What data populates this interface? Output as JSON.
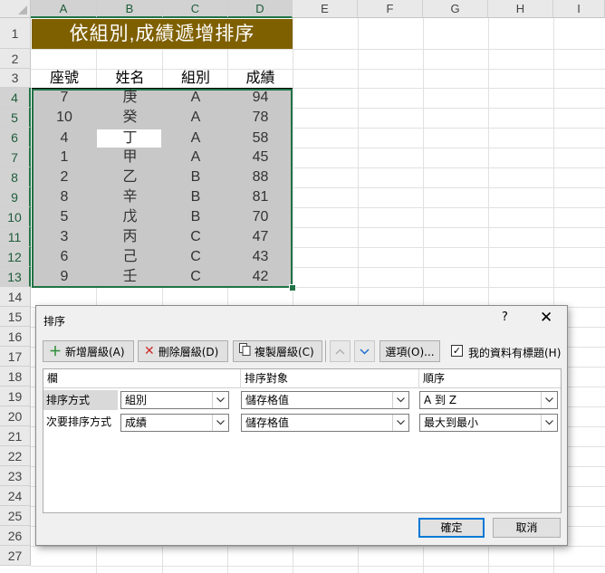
{
  "sheet": {
    "columns": [
      "A",
      "B",
      "C",
      "D",
      "E",
      "F",
      "G",
      "H",
      "I"
    ],
    "rows": [
      "1",
      "2",
      "3",
      "4",
      "5",
      "6",
      "7",
      "8",
      "9",
      "10",
      "11",
      "12",
      "13",
      "14",
      "15",
      "16",
      "17",
      "18",
      "19",
      "20",
      "21",
      "22",
      "23",
      "24",
      "25",
      "26",
      "27"
    ],
    "title": "依組別,成績遞增排序",
    "headers": {
      "seat": "座號",
      "name": "姓名",
      "group": "組別",
      "score": "成績"
    },
    "data": [
      {
        "seat": "7",
        "name": "庚",
        "group": "A",
        "score": "94"
      },
      {
        "seat": "10",
        "name": "癸",
        "group": "A",
        "score": "78"
      },
      {
        "seat": "4",
        "name": "丁",
        "group": "A",
        "score": "58"
      },
      {
        "seat": "1",
        "name": "甲",
        "group": "A",
        "score": "45"
      },
      {
        "seat": "2",
        "name": "乙",
        "group": "B",
        "score": "88"
      },
      {
        "seat": "8",
        "name": "辛",
        "group": "B",
        "score": "81"
      },
      {
        "seat": "5",
        "name": "戊",
        "group": "B",
        "score": "70"
      },
      {
        "seat": "3",
        "name": "丙",
        "group": "C",
        "score": "47"
      },
      {
        "seat": "6",
        "name": "己",
        "group": "C",
        "score": "43"
      },
      {
        "seat": "9",
        "name": "壬",
        "group": "C",
        "score": "42"
      }
    ],
    "accent_color": "#217346",
    "title_bg": "#7f6000"
  },
  "dialog": {
    "title": "排序",
    "help": "?",
    "close": "✕",
    "add_level": "新增層級(A)",
    "delete_level": "刪除層級(D)",
    "copy_level": "複製層級(C)",
    "options": "選項(O)...",
    "has_headers_label": "我的資料有標題(H)",
    "has_headers_checked": true,
    "col_header": "欄",
    "sort_on_header": "排序對象",
    "order_header": "順序",
    "levels": [
      {
        "label": "排序方式",
        "column": "組別",
        "sort_on": "儲存格值",
        "order": "A 到 Z"
      },
      {
        "label": "次要排序方式",
        "column": "成績",
        "sort_on": "儲存格值",
        "order": "最大到最小"
      }
    ],
    "ok": "確定",
    "cancel": "取消"
  }
}
